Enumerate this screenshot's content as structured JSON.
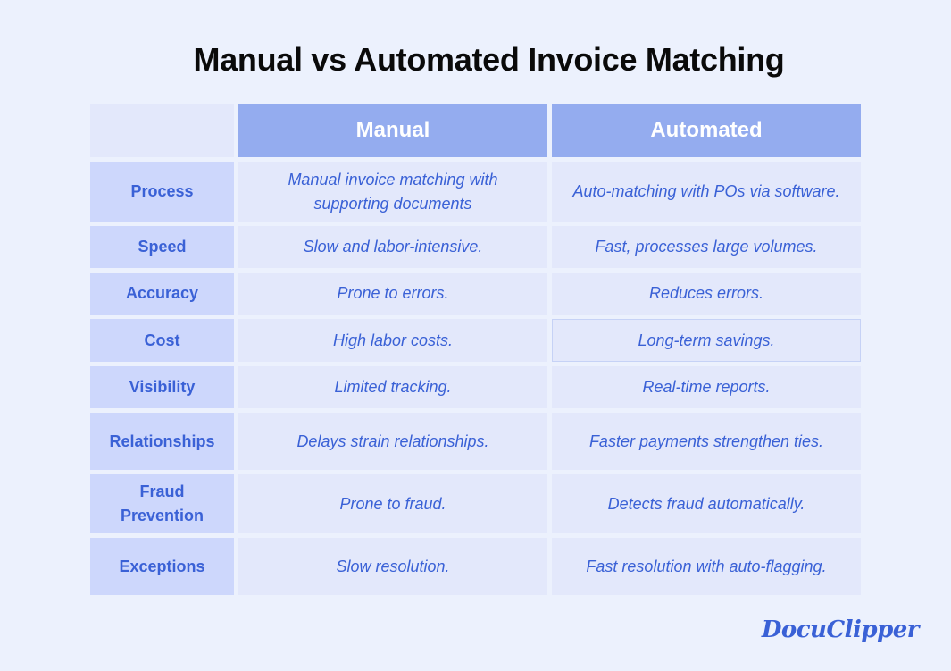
{
  "title": "Manual vs Automated Invoice Matching",
  "table": {
    "headers": [
      "",
      "Manual",
      "Automated"
    ],
    "rows": [
      {
        "label": "Process",
        "manual": "Manual invoice matching with supporting documents",
        "automated": "Auto-matching with POs via software."
      },
      {
        "label": "Speed",
        "manual": "Slow and labor-intensive.",
        "automated": "Fast, processes large volumes."
      },
      {
        "label": "Accuracy",
        "manual": "Prone to errors.",
        "automated": "Reduces errors."
      },
      {
        "label": "Cost",
        "manual": "High labor costs.",
        "automated": "Long-term savings."
      },
      {
        "label": "Visibility",
        "manual": "Limited tracking.",
        "automated": "Real-time reports."
      },
      {
        "label": "Relationships",
        "manual": "Delays strain relationships.",
        "automated": "Faster payments strengthen ties."
      },
      {
        "label": "Fraud Prevention",
        "manual": "Prone to fraud.",
        "automated": "Detects fraud automatically."
      },
      {
        "label": "Exceptions",
        "manual": "Slow resolution.",
        "automated": "Fast resolution with auto-flagging."
      }
    ]
  },
  "logo": "DocuClipper",
  "colors": {
    "header_bg": "#94acef",
    "label_bg": "#cdd7fc",
    "cell_bg": "#e3e8fb",
    "text_accent": "#3a61d6",
    "page_bg": "#ecf1fd"
  }
}
